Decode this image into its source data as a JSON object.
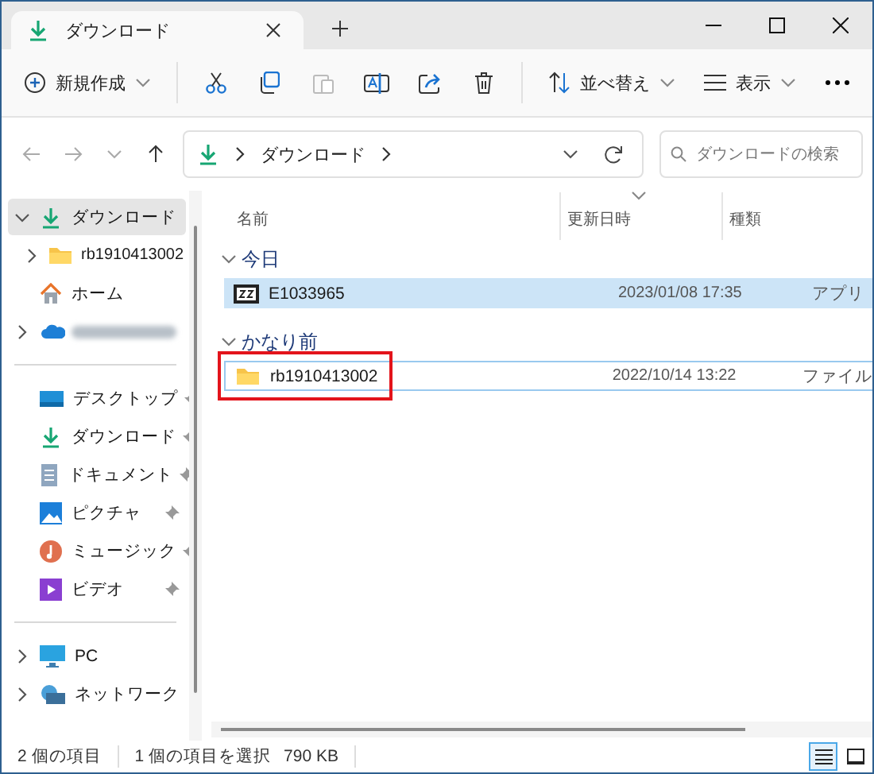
{
  "tabs": [
    {
      "label": "ダウンロード",
      "selected": true
    }
  ],
  "toolbar": {
    "new_button": "新規作成",
    "sort_button": "並べ替え",
    "view_button": "表示",
    "actions": [
      {
        "kind": "cut",
        "disabled": false
      },
      {
        "kind": "copy",
        "disabled": false
      },
      {
        "kind": "paste",
        "disabled": true
      },
      {
        "kind": "rename",
        "disabled": false
      },
      {
        "kind": "share",
        "disabled": false
      },
      {
        "kind": "delete",
        "disabled": false
      }
    ]
  },
  "navigation": [
    {
      "kind": "back",
      "disabled": true
    },
    {
      "kind": "forward",
      "disabled": true
    },
    {
      "kind": "recent",
      "disabled": true
    },
    {
      "kind": "up",
      "disabled": false
    }
  ],
  "address": {
    "path": [
      "ダウンロード"
    ]
  },
  "search": {
    "placeholder": "ダウンロードの検索"
  },
  "sidebar": {
    "sections": [
      [
        {
          "kind": "downloads",
          "label": "ダウンロード",
          "expanded": true,
          "selected": true
        },
        {
          "kind": "folder",
          "label": "rb1910413002",
          "expanded": false,
          "selected": false
        },
        {
          "kind": "home",
          "label": "ホーム",
          "selected": false
        },
        {
          "kind": "cloud",
          "expanded": false,
          "selected": false
        }
      ],
      [
        {
          "kind": "desktop",
          "label": "デスクトップ",
          "selected": false,
          "pinned": true
        },
        {
          "kind": "downloads",
          "label": "ダウンロード",
          "selected": false,
          "pinned": true
        },
        {
          "kind": "documents",
          "label": "ドキュメント",
          "selected": false,
          "pinned": true
        },
        {
          "kind": "pictures",
          "label": "ピクチャ",
          "selected": false,
          "pinned": true
        },
        {
          "kind": "music",
          "label": "ミュージック",
          "selected": false,
          "pinned": true
        },
        {
          "kind": "videos",
          "label": "ビデオ",
          "selected": false,
          "pinned": true
        }
      ],
      [
        {
          "kind": "pc",
          "label": "PC",
          "expanded": false,
          "selected": false
        },
        {
          "kind": "network",
          "label": "ネットワーク",
          "expanded": false,
          "selected": false
        }
      ]
    ]
  },
  "file_list": {
    "columns": [
      {
        "label": "名前",
        "sorted": false
      },
      {
        "label": "更新日時",
        "sorted": true
      },
      {
        "label": "種類",
        "sorted": false
      }
    ],
    "groups": [
      {
        "label": "今日",
        "expanded": true,
        "rows": [
          {
            "kind": "archive",
            "name": "E1033965",
            "modified": "2023/01/08 17:35",
            "type": "アプリ",
            "selected": true,
            "highlighted": false
          }
        ]
      },
      {
        "label": "かなり前",
        "expanded": true,
        "rows": [
          {
            "kind": "folder",
            "name": "rb1910413002",
            "modified": "2022/10/14 13:22",
            "type": "ファイル",
            "selected": false,
            "highlighted": true
          }
        ]
      }
    ]
  },
  "status_bar": {
    "item_count": "2 個の項目",
    "selection": "1 個の項目を選択",
    "size": "790 KB",
    "views": [
      {
        "kind": "details",
        "selected": true
      },
      {
        "kind": "tiles",
        "selected": false
      }
    ]
  }
}
